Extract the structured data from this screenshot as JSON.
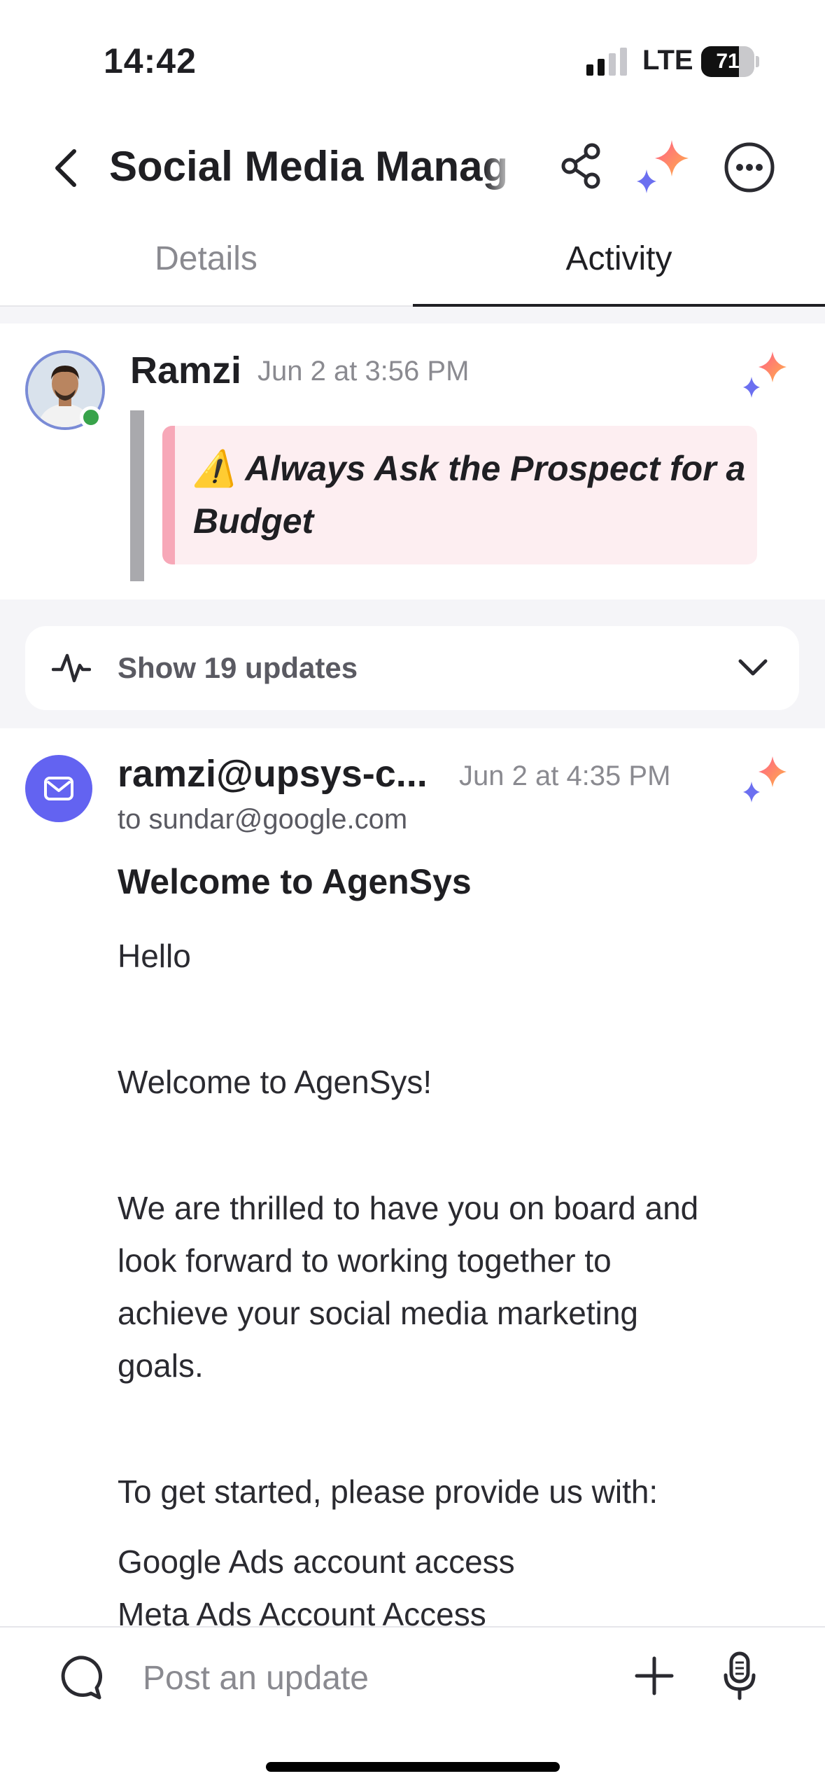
{
  "status_bar": {
    "time": "14:42",
    "network": "LTE",
    "battery": "71",
    "battery_level": 0.71
  },
  "header": {
    "title": "Social Media Manag",
    "icons": [
      "chevron-left-icon",
      "share-icon",
      "ai-sparkle-icon",
      "more-icon"
    ]
  },
  "tabs": {
    "details": "Details",
    "activity": "Activity",
    "selected": "Activity"
  },
  "comment": {
    "author": "Ramzi",
    "time": "Jun 2 at 3:56 PM",
    "callout": "⚠️ Always Ask the Prospect for a Budget"
  },
  "updates": {
    "label": "Show 19 updates"
  },
  "email": {
    "sender": "ramzi@upsys-c...",
    "time": "Jun 2 at 4:35 PM",
    "to": "to sundar@google.com",
    "subject": "Welcome to AgenSys",
    "greeting": "Hello",
    "welcome": "Welcome to AgenSys!",
    "paragraph_lines": [
      "We are thrilled to have you on board and",
      "look forward to working together to",
      "achieve your social media marketing",
      "goals."
    ],
    "prompt": "To get started, please provide us with:",
    "item1": "Google Ads account access",
    "item2": "Meta Ads Account Access"
  },
  "composer": {
    "placeholder": "Post an update"
  },
  "colors": {
    "accent": "#6363f1",
    "online": "#38a34a",
    "callout_bg": "#fdeef1",
    "callout_edge": "#f7a8b8"
  }
}
